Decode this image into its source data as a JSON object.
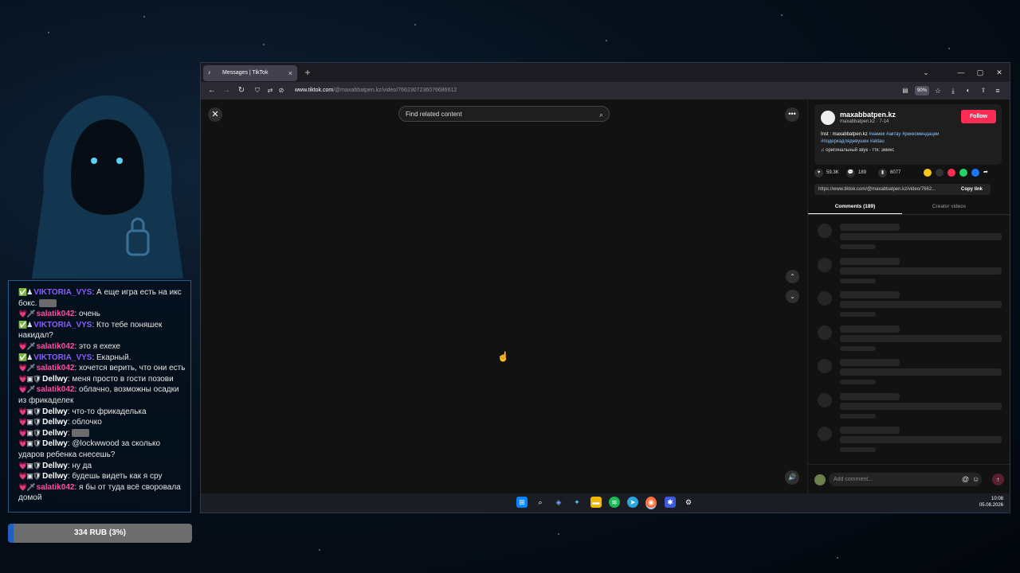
{
  "chat": {
    "messages": [
      {
        "user": "VIKTORIA_VYS",
        "cls": "u-vik",
        "badges": "✅♟",
        "text": "А еще игра есть на икс бокс.",
        "emote": true
      },
      {
        "user": "salatik042",
        "cls": "u-sal",
        "badges": "💗🗡",
        "text": "очень",
        "emote": false
      },
      {
        "user": "VIKTORIA_VYS",
        "cls": "u-vik",
        "badges": "✅♟",
        "text": "Кто тебе поняшек накидал?",
        "emote": false
      },
      {
        "user": "salatik042",
        "cls": "u-sal",
        "badges": "💗🗡",
        "text": "это я ехехе",
        "emote": false
      },
      {
        "user": "VIKTORIA_VYS",
        "cls": "u-vik",
        "badges": "✅♟",
        "text": "Екарный.",
        "emote": false
      },
      {
        "user": "salatik042",
        "cls": "u-sal",
        "badges": "💗🗡",
        "text": "хочется верить, что они есть",
        "emote": false
      },
      {
        "user": "Dellwy",
        "cls": "u-del",
        "badges": "💗▣🛡",
        "text": "меня просто в гости позови",
        "emote": false
      },
      {
        "user": "salatik042",
        "cls": "u-sal",
        "badges": "💗🗡",
        "text": "облачно, возможны осадки из фрикаделек",
        "emote": false
      },
      {
        "user": "Dellwy",
        "cls": "u-del",
        "badges": "💗▣🛡",
        "text": "что-то фрикаделька",
        "emote": false
      },
      {
        "user": "Dellwy",
        "cls": "u-del",
        "badges": "💗▣🛡",
        "text": "облочко",
        "emote": false
      },
      {
        "user": "Dellwy",
        "cls": "u-del",
        "badges": "💗▣🛡",
        "text": "",
        "emote": true
      },
      {
        "user": "Dellwy",
        "cls": "u-del",
        "badges": "💗▣🛡",
        "text": "@lockwwood за сколько ударов ребенка снесешь?",
        "emote": false
      },
      {
        "user": "Dellwy",
        "cls": "u-del",
        "badges": "💗▣🛡",
        "text": "ну да",
        "emote": false
      },
      {
        "user": "Dellwy",
        "cls": "u-del",
        "badges": "💗▣🛡",
        "text": "будешь видеть как я сру",
        "emote": false
      },
      {
        "user": "salatik042",
        "cls": "u-sal",
        "badges": "💗🗡",
        "text": "я бы от туда всё своровала домой",
        "emote": false
      }
    ]
  },
  "donation": {
    "label": "334 RUB (3%)",
    "progress": 0.03
  },
  "browser": {
    "tab_title": "Messages | TikTok",
    "url_domain": "www.tiktok.com",
    "url_path": "/@maxabbatpen.kz/video/7662307236076686612",
    "zoom": "90%"
  },
  "video": {
    "search_placeholder": "Find related content"
  },
  "post": {
    "username": "maxabbatpen.kz",
    "subline": "maxabbatpen.kz · 7-14",
    "follow_label": "Follow",
    "desc_plain": "Inst : maxabbatpen.kz ",
    "tags_line1": "#намек #актау #реккомендации",
    "tags_line2": "#подеркадлядевушек #aktau",
    "sound": "оригинальный звук - ттк: эмикс",
    "likes": "59.3K",
    "comments": "189",
    "saves": "6077",
    "link": "https://www.tiktok.com/@maxabbatpen.kz/video/7662...",
    "copy_label": "Copy link",
    "tab_comments": "Comments (189)",
    "tab_creator": "Creator videos",
    "comment_placeholder": "Add comment..."
  },
  "taskbar": {
    "time": "10:08",
    "date": "05.08.2026"
  }
}
